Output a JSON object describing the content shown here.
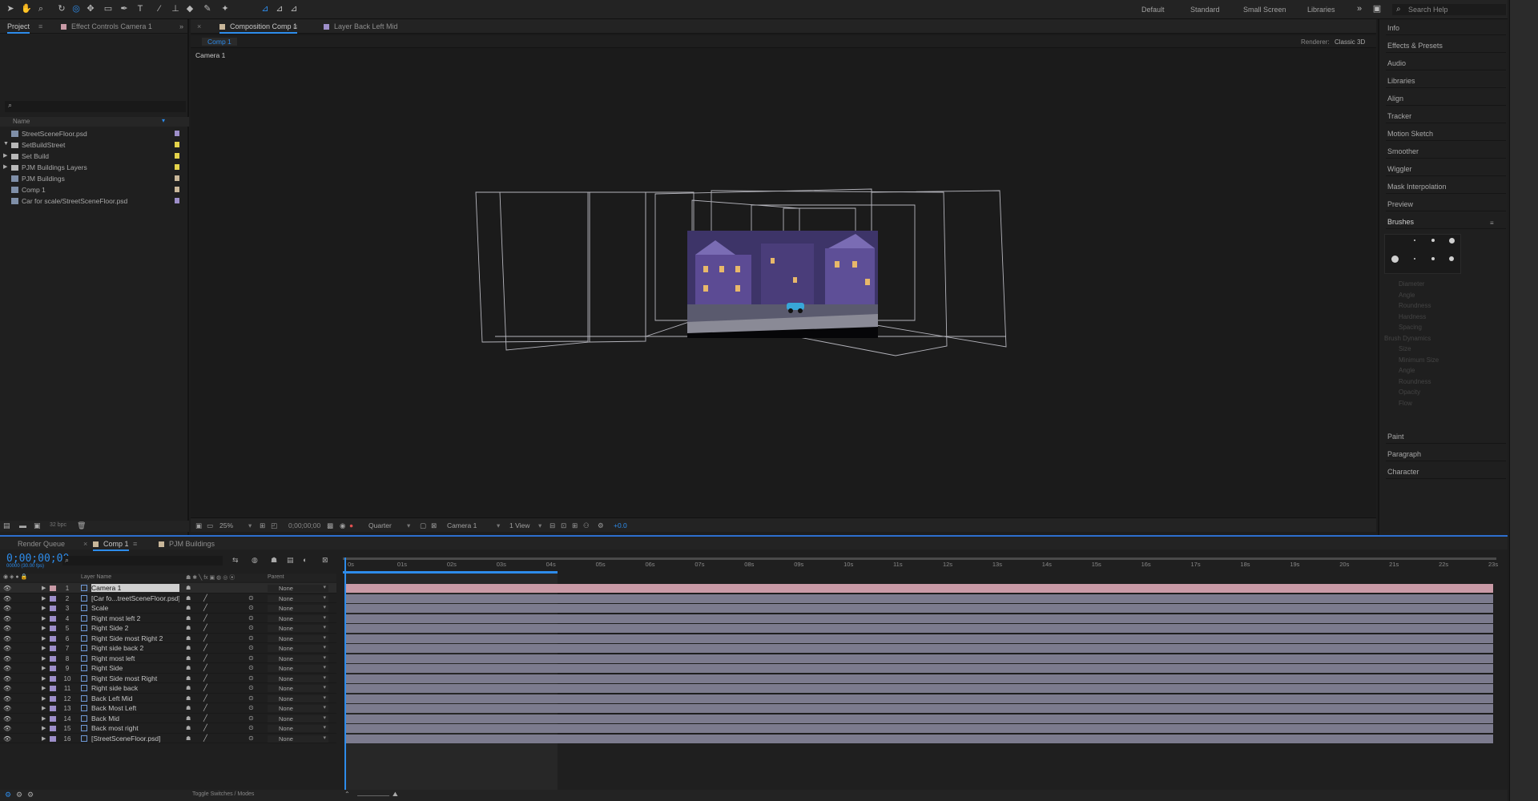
{
  "toolbar": {
    "workspaces": [
      "Default",
      "Standard",
      "Small Screen",
      "Libraries"
    ],
    "search_placeholder": "Search Help"
  },
  "project_panel": {
    "tabs": [
      "Project",
      "Effect Controls Camera 1"
    ],
    "column_name": "Name",
    "items": [
      {
        "name": "StreetSceneFloor.psd",
        "type": "file",
        "label_color": "#9d8ec9"
      },
      {
        "name": "SetBuildStreet",
        "type": "folder",
        "label_color": "#e4d34a"
      },
      {
        "name": "Set Build",
        "type": "folder",
        "label_color": "#e4d34a"
      },
      {
        "name": "PJM Buildings Layers",
        "type": "folder",
        "label_color": "#e4d34a"
      },
      {
        "name": "PJM Buildings",
        "type": "comp",
        "label_color": "#c9b79a"
      },
      {
        "name": "Comp 1",
        "type": "comp",
        "label_color": "#c9b79a"
      },
      {
        "name": "Car for scale/StreetSceneFloor.psd",
        "type": "file",
        "label_color": "#9d8ec9"
      }
    ],
    "bit_depth": "32 bpc"
  },
  "composition": {
    "tabs": [
      "Composition Comp 1",
      "Layer Back Left Mid"
    ],
    "sub_tab": "Comp 1",
    "renderer_label": "Renderer:",
    "renderer_value": "Classic 3D",
    "active_camera": "Camera 1",
    "footer": {
      "zoom": "25%",
      "timecode": "0;00;00;00",
      "resolution": "Quarter",
      "camera": "Camera 1",
      "view": "1 View",
      "exposure": "+0.0"
    }
  },
  "right_panel": {
    "items_top": [
      "Info",
      "Effects & Presets",
      "Audio",
      "Libraries",
      "Align",
      "Tracker",
      "Motion Sketch",
      "Smoother",
      "Wiggler",
      "Mask Interpolation",
      "Preview",
      "Brushes"
    ],
    "items_bottom": [
      "Paint",
      "Paragraph",
      "Character"
    ],
    "brush_props": [
      "Diameter",
      "Angle",
      "Roundness",
      "Hardness",
      "Spacing",
      "Brush Dynamics",
      "Size",
      "Minimum Size",
      "Angle",
      "Roundness",
      "Opacity",
      "Flow"
    ]
  },
  "timeline": {
    "tabs": [
      "Render Queue",
      "Comp 1",
      "PJM Buildings"
    ],
    "timecode": "0;00;00;00",
    "timecode_sub": "00000 (30.00 fps)",
    "col_layer_name": "Layer Name",
    "col_parent": "Parent",
    "footer_label": "Toggle Switches / Modes",
    "ruler": [
      "0s",
      "01s",
      "02s",
      "03s",
      "04s",
      "05s",
      "06s",
      "07s",
      "08s",
      "09s",
      "10s",
      "11s",
      "12s",
      "13s",
      "14s",
      "15s",
      "16s",
      "17s",
      "18s",
      "19s",
      "20s",
      "21s",
      "22s",
      "23s"
    ],
    "layers": [
      {
        "num": "1",
        "name": "Camera 1",
        "color": "#c99aa6",
        "parent": "None"
      },
      {
        "num": "2",
        "name": "[Car fo...treetSceneFloor.psd]",
        "color": "#9d8ec9",
        "parent": "None"
      },
      {
        "num": "3",
        "name": "Scale",
        "color": "#9d8ec9",
        "parent": "None"
      },
      {
        "num": "4",
        "name": "Right most left 2",
        "color": "#9d8ec9",
        "parent": "None"
      },
      {
        "num": "5",
        "name": "Right Side 2",
        "color": "#9d8ec9",
        "parent": "None"
      },
      {
        "num": "6",
        "name": "Right Side most Right 2",
        "color": "#9d8ec9",
        "parent": "None"
      },
      {
        "num": "7",
        "name": "Right side back 2",
        "color": "#9d8ec9",
        "parent": "None"
      },
      {
        "num": "8",
        "name": "Right most left",
        "color": "#9d8ec9",
        "parent": "None"
      },
      {
        "num": "9",
        "name": "Right Side",
        "color": "#9d8ec9",
        "parent": "None"
      },
      {
        "num": "10",
        "name": "Right Side most Right",
        "color": "#9d8ec9",
        "parent": "None"
      },
      {
        "num": "11",
        "name": "Right side back",
        "color": "#9d8ec9",
        "parent": "None"
      },
      {
        "num": "12",
        "name": "Back Left Mid",
        "color": "#9d8ec9",
        "parent": "None"
      },
      {
        "num": "13",
        "name": "Back Most Left",
        "color": "#9d8ec9",
        "parent": "None"
      },
      {
        "num": "14",
        "name": "Back Mid",
        "color": "#9d8ec9",
        "parent": "None"
      },
      {
        "num": "15",
        "name": "Back most right",
        "color": "#9d8ec9",
        "parent": "None"
      },
      {
        "num": "16",
        "name": "[StreetSceneFloor.psd]",
        "color": "#9d8ec9",
        "parent": "None"
      }
    ]
  },
  "colors": {
    "accent": "#2d8ceb",
    "camera_bar": "#c99aa6",
    "layer_bar": "#7c7b8e"
  }
}
